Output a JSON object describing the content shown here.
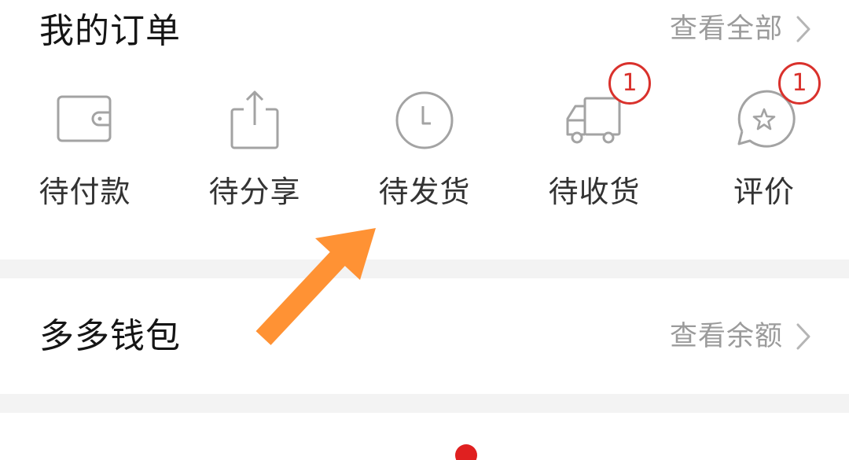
{
  "orders": {
    "title": "我的订单",
    "view_all": "查看全部",
    "items": [
      {
        "label": "待付款",
        "icon": "wallet-icon",
        "badge": null
      },
      {
        "label": "待分享",
        "icon": "share-icon",
        "badge": null
      },
      {
        "label": "待发货",
        "icon": "clock-icon",
        "badge": null
      },
      {
        "label": "待收货",
        "icon": "truck-icon",
        "badge": "1"
      },
      {
        "label": "评价",
        "icon": "review-star-icon",
        "badge": "1"
      }
    ]
  },
  "wallet": {
    "title": "多多钱包",
    "view_balance": "查看余额"
  },
  "colors": {
    "title_text": "#151515",
    "muted_text": "#9b9b9b",
    "icon_stroke": "#a3a3a3",
    "badge": "#d9312c",
    "separator": "#f3f3f3",
    "annotation_arrow": "#ff9234",
    "notification_dot": "#e02020"
  }
}
